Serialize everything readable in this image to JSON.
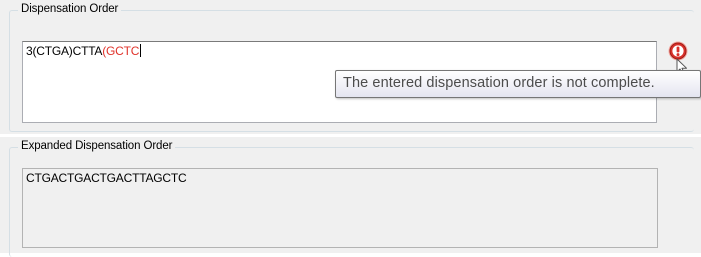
{
  "dispensation_group": {
    "legend": "Dispensation Order",
    "input": {
      "value_normal": "3(CTGA)CTTA",
      "value_error": "(GCTC"
    },
    "error_tooltip": "The entered dispensation order is not complete."
  },
  "expanded_group": {
    "legend": "Expanded Dispensation Order",
    "value": "CTGACTGACTGACTTAGCTC"
  },
  "colors": {
    "error_text": "#e0332b",
    "error_icon": "#d8302a",
    "panel_background": "#f0f0f0"
  },
  "icons": {
    "error": "error-exclamation-icon",
    "pointer": "mouse-cursor-icon"
  }
}
